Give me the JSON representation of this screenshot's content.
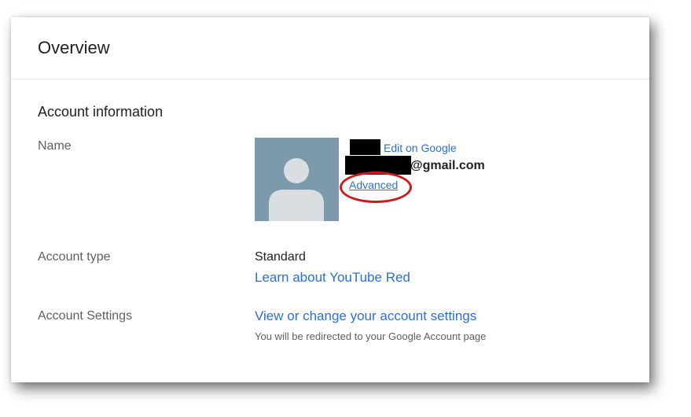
{
  "header": {
    "title": "Overview"
  },
  "account_information": {
    "section_title": "Account information",
    "name": {
      "label": "Name",
      "avatar_icon": "default-person-avatar-icon",
      "edit_link": "Edit on Google",
      "email_suffix": "@gmail.com",
      "advanced_link": "Advanced"
    },
    "account_type": {
      "label": "Account type",
      "value": "Standard",
      "link": "Learn about YouTube Red"
    },
    "account_settings": {
      "label": "Account Settings",
      "link": "View or change your account settings",
      "hint": "You will be redirected to your Google Account page"
    }
  },
  "colors": {
    "link": "#2a6fd6",
    "avatar_bg": "#7d9aad",
    "highlight": "#d01818"
  }
}
